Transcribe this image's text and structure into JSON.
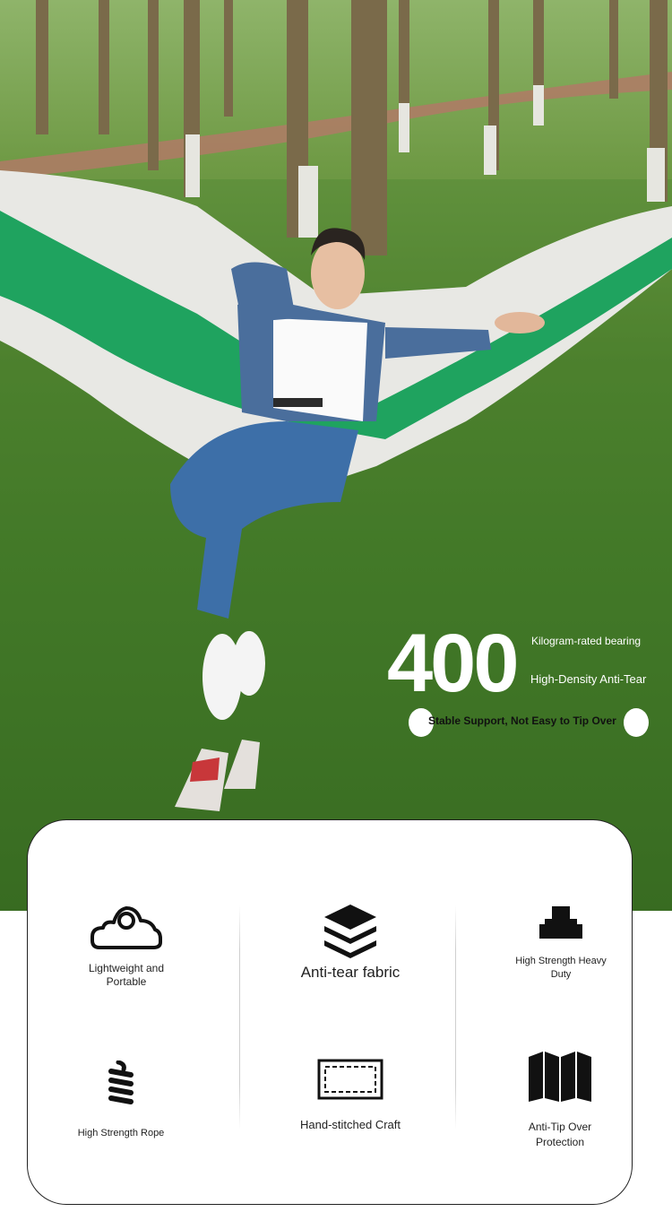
{
  "hero": {
    "stat_value": "400",
    "stat_line1": "Kilogram-rated bearing",
    "stat_line2": "High-Density Anti-Tear",
    "pill_text": "Stable Support, Not Easy to Tip Over"
  },
  "features": [
    {
      "label": "Lightweight and Portable",
      "icon": "cloud-icon"
    },
    {
      "label": "Anti-tear fabric",
      "icon": "layers-icon"
    },
    {
      "label": "High Strength Heavy Duty",
      "icon": "weight-icon"
    },
    {
      "label": "High Strength Rope",
      "icon": "rope-icon"
    },
    {
      "label": "Hand-stitched Craft",
      "icon": "stitch-icon"
    },
    {
      "label": "Anti-Tip Over Protection",
      "icon": "folding-screen-icon"
    }
  ],
  "colors": {
    "hammock_green": "#1fa35f",
    "hammock_white": "#e8e8e4",
    "grass": "#3f7424"
  }
}
